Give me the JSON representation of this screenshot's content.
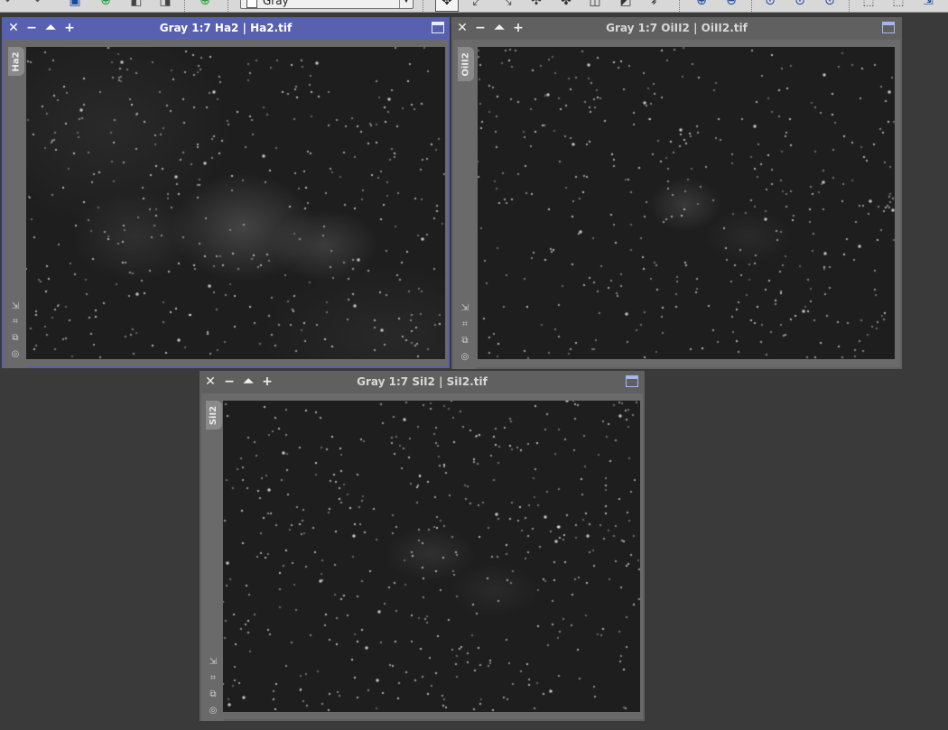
{
  "toolbar": {
    "color_mode": "Gray",
    "icons": [
      "redo-icon",
      "new-image-icon",
      "add-icon",
      "duplicate-icon",
      "clone-icon",
      "add-process-icon",
      "color-swatch-icon",
      "dropdown-chevron-icon",
      "pan-icon",
      "zoom-fit-icon",
      "expand-icon",
      "move-icon",
      "center-icon",
      "panel-icon",
      "preview-icon",
      "pointer-icon",
      "zoom-in-icon",
      "zoom-out-icon",
      "zoom-1-icon",
      "zoom-2-icon",
      "zoom-3-icon",
      "select-rect-icon",
      "select-preview-icon",
      "export-icon"
    ]
  },
  "windows": [
    {
      "id": "ha2",
      "title": "Gray 1:7 Ha2 | Ha2.tif",
      "identifier": "Ha2",
      "active": true
    },
    {
      "id": "oiii2",
      "title": "Gray 1:7 OiII2 | OiII2.tif",
      "identifier": "OiII2",
      "active": false
    },
    {
      "id": "sii2",
      "title": "Gray 1:7 SiI2 | SiI2.tif",
      "identifier": "SiI2",
      "active": false
    }
  ],
  "colors": {
    "active_title": "#5860b0",
    "inactive_title": "#606060",
    "workspace": "#3a3a3a"
  }
}
